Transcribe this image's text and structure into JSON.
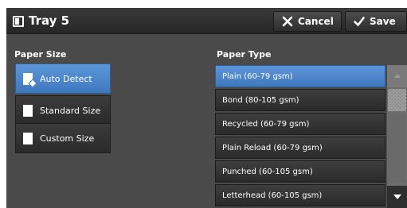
{
  "header": {
    "title": "Tray 5",
    "cancel_label": "Cancel",
    "save_label": "Save",
    "icons": {
      "tray": "tray-icon",
      "cancel": "x-icon",
      "save": "checkmark-icon"
    }
  },
  "paper_size": {
    "label": "Paper Size",
    "options": [
      {
        "label": "Auto Detect",
        "selected": true,
        "icon": "auto-detect-icon"
      },
      {
        "label": "Standard Size",
        "selected": false,
        "icon": "page-icon"
      },
      {
        "label": "Custom Size",
        "selected": false,
        "icon": "page-icon"
      }
    ]
  },
  "paper_type": {
    "label": "Paper Type",
    "items": [
      {
        "label": "Plain (60-79 gsm)",
        "selected": true
      },
      {
        "label": "Bond (80-105 gsm)",
        "selected": false
      },
      {
        "label": "Recycled (60-79 gsm)",
        "selected": false
      },
      {
        "label": "Plain Reload (60-79 gsm)",
        "selected": false
      },
      {
        "label": "Punched (60-105 gsm)",
        "selected": false
      },
      {
        "label": "Letterhead (60-105 gsm)",
        "selected": false
      }
    ]
  },
  "colors": {
    "accent": "#4a86cc",
    "background": "#4a4a4a",
    "header": "#2e2e2e",
    "text": "#ffffff"
  }
}
